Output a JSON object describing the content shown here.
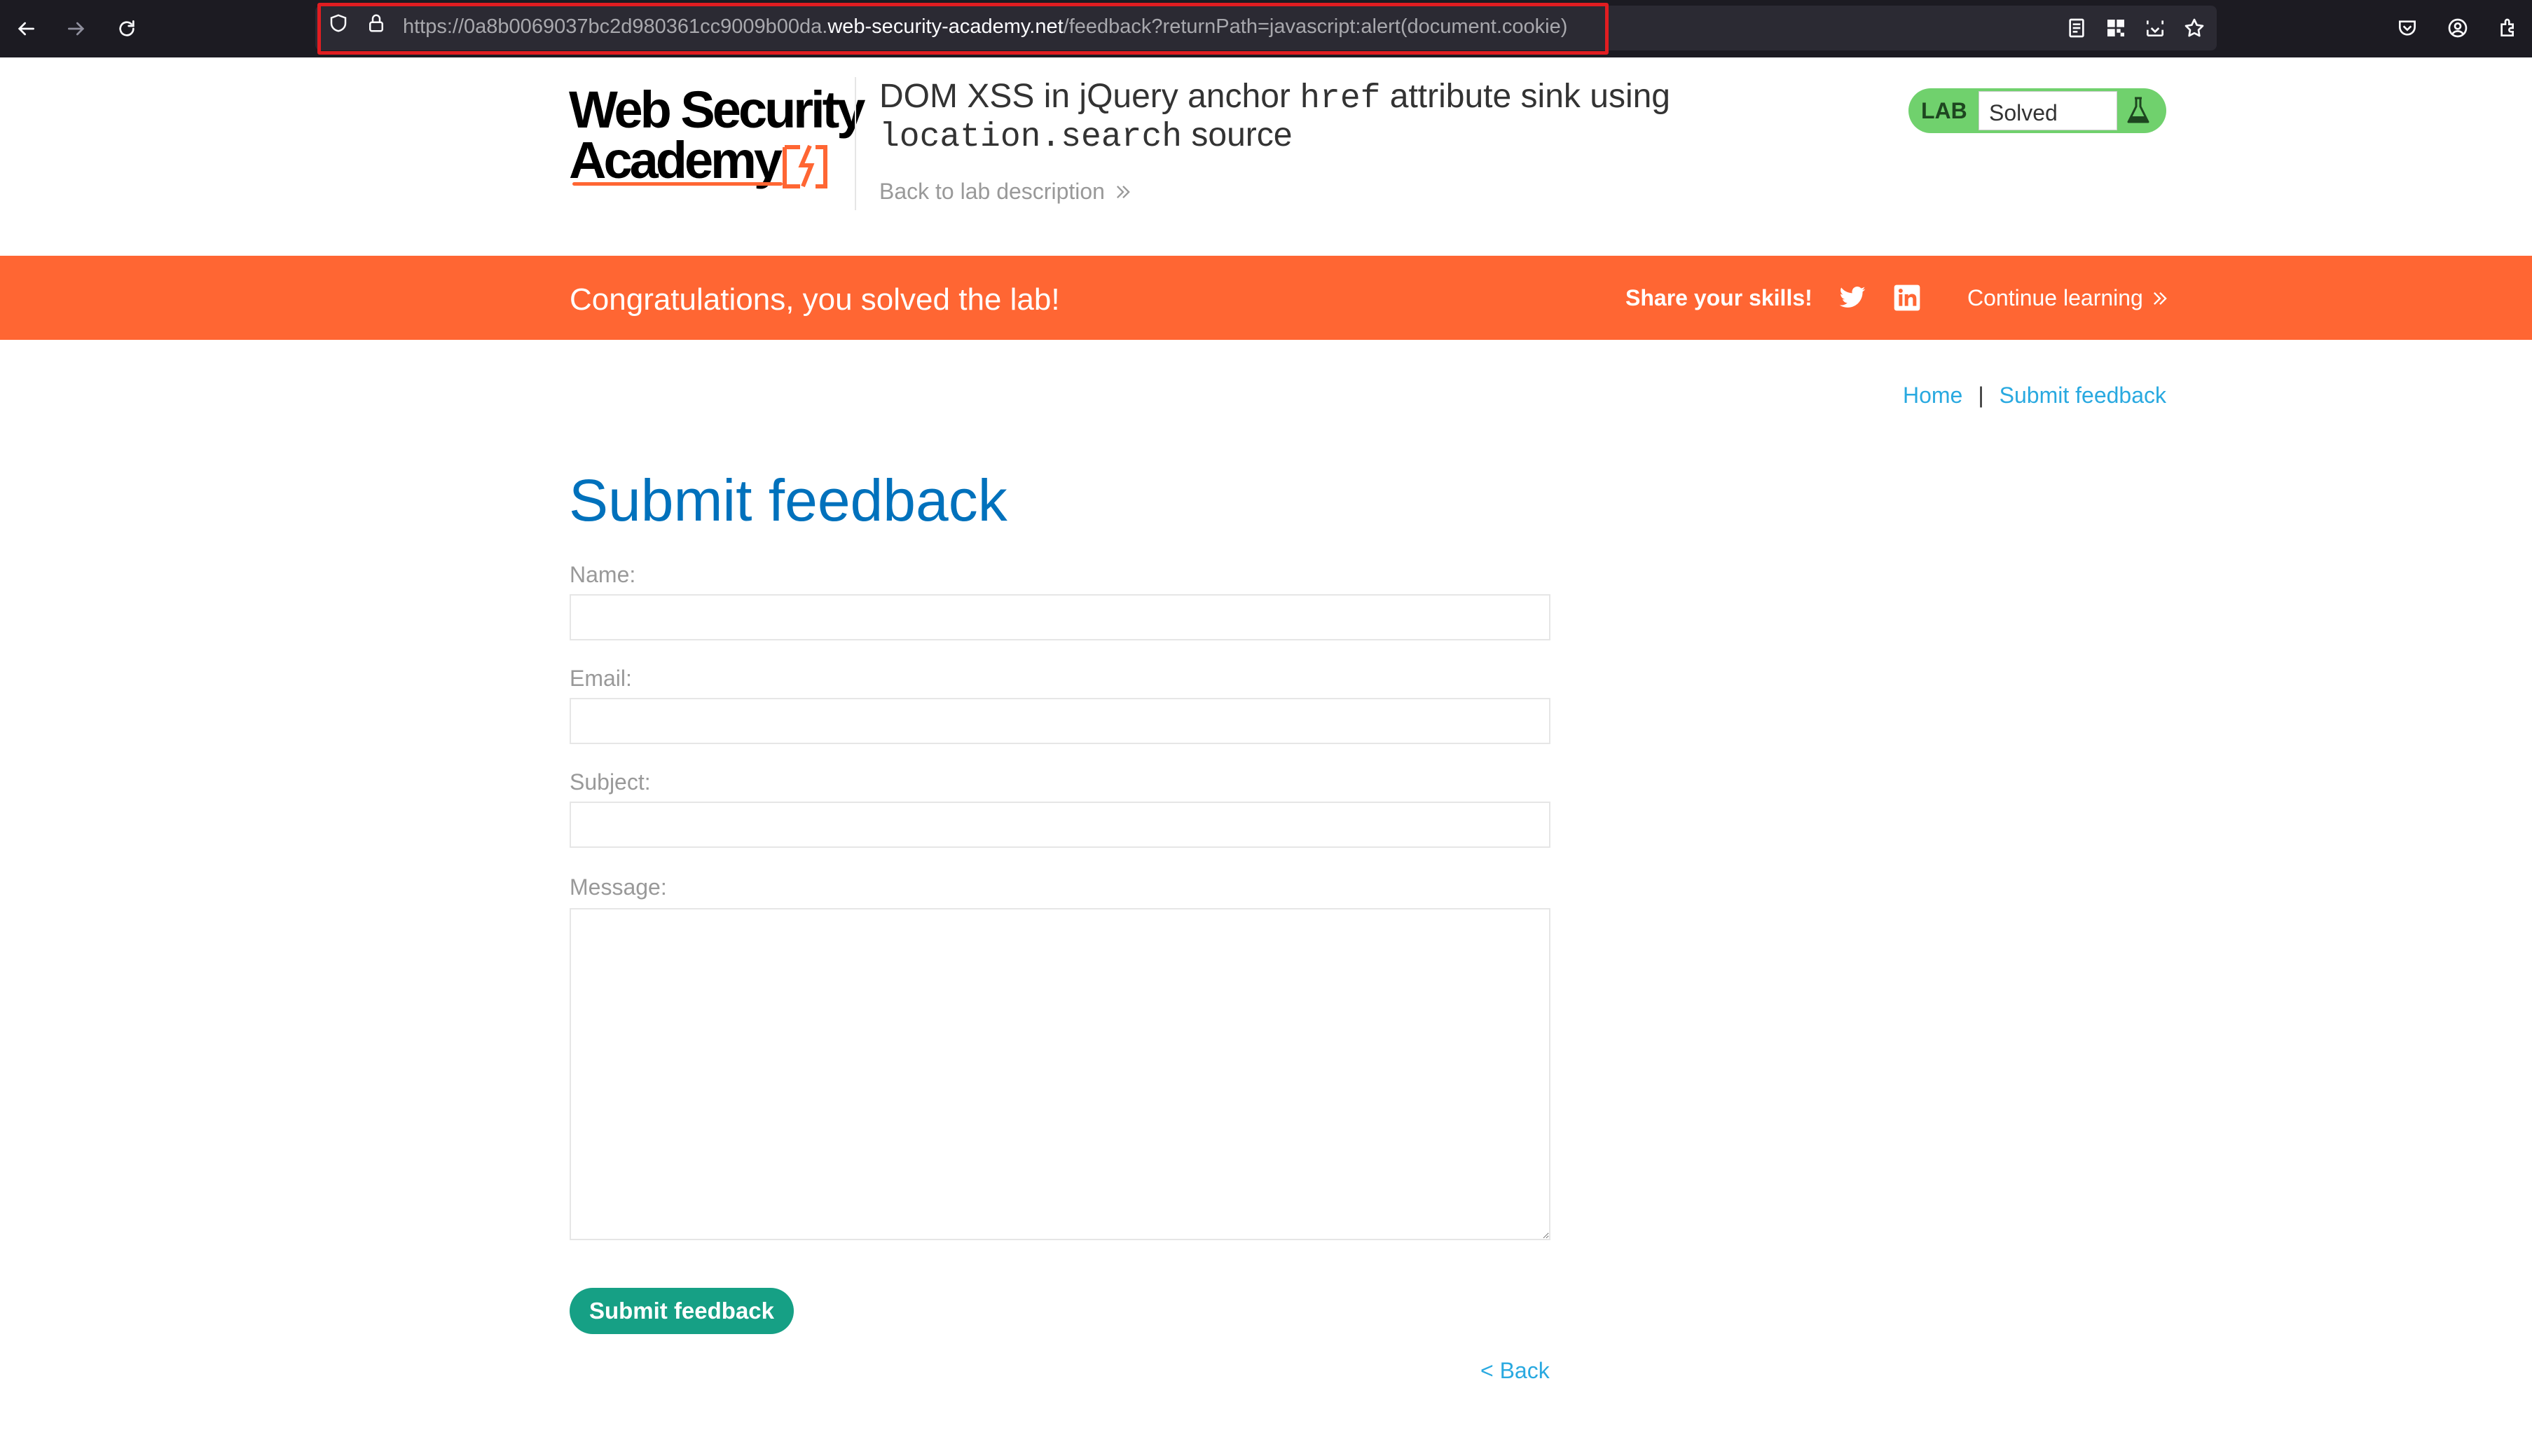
{
  "browser": {
    "url_prefix": "https://0a8b0069037bc2d980361cc9009b00da.",
    "url_host": "web-security-academy.net",
    "url_suffix": "/feedback?returnPath=javascript:alert(document.cookie)"
  },
  "header": {
    "logo_line1": "Web Security",
    "logo_line2": "Academy",
    "title_part1": "DOM XSS in jQuery anchor ",
    "title_code1": "href",
    "title_part2": " attribute sink using ",
    "title_code2": "location.search",
    "title_part3": " source",
    "back_to_description": "Back to lab description",
    "lab_label": "LAB",
    "lab_status": "Solved"
  },
  "banner": {
    "message": "Congratulations, you solved the lab!",
    "share_label": "Share your skills!",
    "continue_label": "Continue learning"
  },
  "breadcrumb": {
    "home": "Home",
    "separator": "|",
    "current": "Submit feedback"
  },
  "form": {
    "title": "Submit feedback",
    "name_label": "Name:",
    "email_label": "Email:",
    "subject_label": "Subject:",
    "message_label": "Message:",
    "submit_label": "Submit feedback",
    "back_label": "< Back"
  },
  "colors": {
    "accent_orange": "#ff6633",
    "link_blue": "#29a9e0",
    "title_blue": "#0071bc",
    "button_green": "#16a085",
    "lab_badge_green": "#70d16d"
  }
}
